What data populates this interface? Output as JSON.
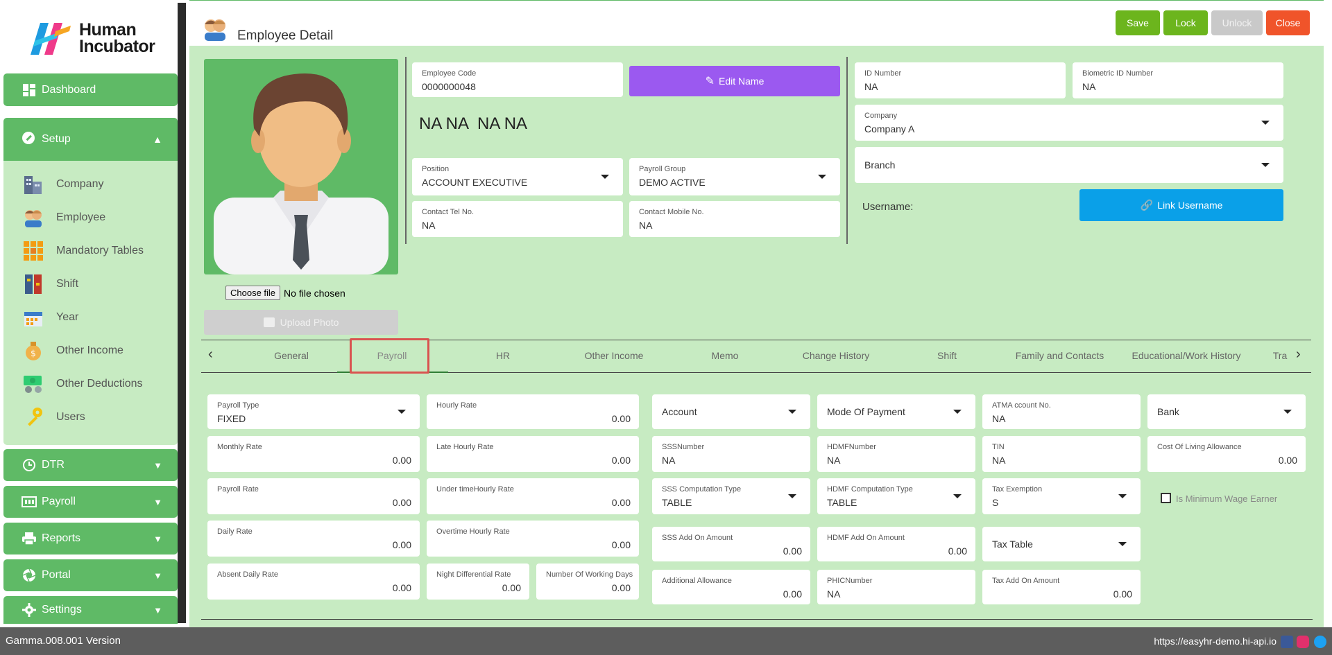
{
  "brand": {
    "line1": "Human",
    "line2": "Incubator"
  },
  "sidebar": {
    "dashboard": "Dashboard",
    "setup": "Setup",
    "setup_items": [
      "Company",
      "Employee",
      "Mandatory Tables",
      "Shift",
      "Year",
      "Other Income",
      "Other Deductions",
      "Users"
    ],
    "dtr": "DTR",
    "payroll": "Payroll",
    "reports": "Reports",
    "portal": "Portal",
    "settings": "Settings"
  },
  "header": {
    "title": "Employee Detail",
    "buttons": {
      "save": "Save",
      "lock": "Lock",
      "unlock": "Unlock",
      "close": "Close"
    }
  },
  "profile": {
    "choose_file": "Choose file",
    "no_file": "No file chosen",
    "upload_photo": "Upload Photo",
    "employee_code_label": "Employee Code",
    "employee_code": "0000000048",
    "edit_name": "Edit Name",
    "full_name": "NA NA  NA NA",
    "position_label": "Position",
    "position": "ACCOUNT EXECUTIVE",
    "payroll_group_label": "Payroll Group",
    "payroll_group": "DEMO ACTIVE",
    "contact_tel_label": "Contact Tel No.",
    "contact_tel": "NA",
    "contact_mobile_label": "Contact Mobile No.",
    "contact_mobile": "NA",
    "id_number_label": "ID Number",
    "id_number": "NA",
    "biometric_label": "Biometric ID Number",
    "biometric": "NA",
    "company_label": "Company",
    "company": "Company A",
    "branch": "Branch",
    "username_label": "Username:",
    "link_username": "Link Username"
  },
  "tabs": [
    "General",
    "Payroll",
    "HR",
    "Other Income",
    "Memo",
    "Change History",
    "Shift",
    "Family and Contacts",
    "Educational/Work History",
    "Tra"
  ],
  "payroll": {
    "payroll_type_label": "Payroll Type",
    "payroll_type": "FIXED",
    "hourly_rate_label": "Hourly Rate",
    "hourly_rate": "0.00",
    "monthly_rate_label": "Monthly Rate",
    "monthly_rate": "0.00",
    "late_hourly_label": "Late Hourly Rate",
    "late_hourly": "0.00",
    "payroll_rate_label": "Payroll Rate",
    "payroll_rate": "0.00",
    "undertime_label": "Under timeHourly Rate",
    "undertime": "0.00",
    "daily_rate_label": "Daily Rate",
    "daily_rate": "0.00",
    "overtime_label": "Overtime Hourly Rate",
    "overtime": "0.00",
    "absent_label": "Absent Daily Rate",
    "absent": "0.00",
    "night_diff_label": "Night Differential Rate",
    "night_diff": "0.00",
    "working_days_label": "Number Of Working Days",
    "working_days": "0.00",
    "account": "Account",
    "mode_of_payment": "Mode Of Payment",
    "atm_label": "ATMA ccount No.",
    "atm": "NA",
    "bank": "Bank",
    "sss_label": "SSSNumber",
    "sss": "NA",
    "hdmf_label": "HDMFNumber",
    "hdmf": "NA",
    "tin_label": "TIN",
    "tin": "NA",
    "cola_label": "Cost Of Living Allowance",
    "cola": "0.00",
    "sss_comp_label": "SSS Computation Type",
    "sss_comp": "TABLE",
    "hdmf_comp_label": "HDMF Computation Type",
    "hdmf_comp": "TABLE",
    "tax_exempt_label": "Tax Exemption",
    "tax_exempt": "S",
    "min_wage": "Is Minimum Wage Earner",
    "sss_addon_label": "SSS Add On Amount",
    "sss_addon": "0.00",
    "hdmf_addon_label": "HDMF Add On Amount",
    "hdmf_addon": "0.00",
    "tax_table": "Tax Table",
    "add_allow_label": "Additional Allowance",
    "add_allow": "0.00",
    "phic_label": "PHICNumber",
    "phic": "NA",
    "tax_addon_label": "Tax Add On Amount",
    "tax_addon": "0.00"
  },
  "footer": {
    "version": "Gamma.008.001 Version",
    "url": "https://easyhr-demo.hi-api.io"
  },
  "colors": {
    "green": "#5fba66",
    "panel": "#c7ebc2",
    "purple": "#9b59f0",
    "blue": "#0aa0e8",
    "red": "#f0542a",
    "lime": "#6cb51d"
  }
}
